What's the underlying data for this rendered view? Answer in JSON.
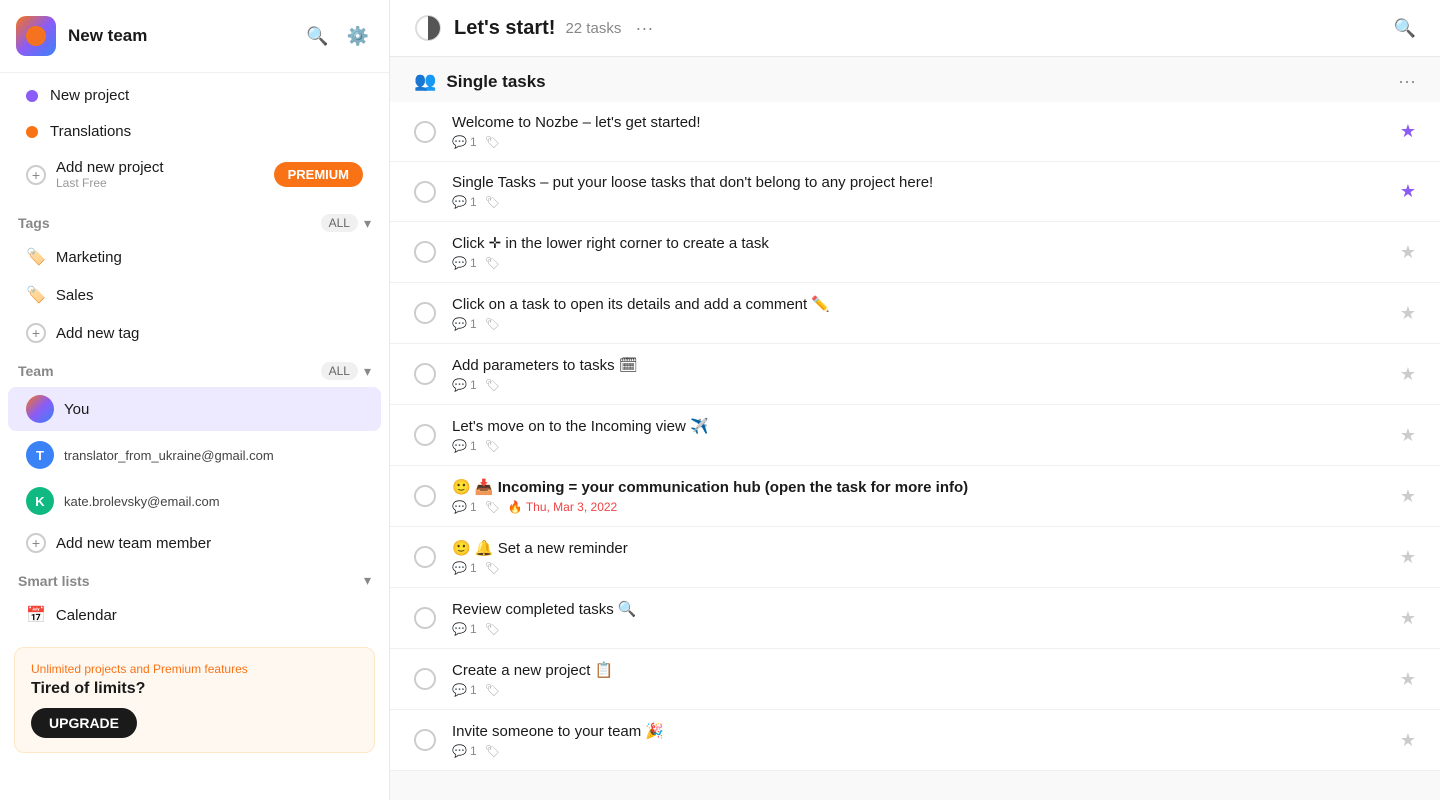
{
  "app": {
    "team_name": "New team",
    "logo_alt": "Nozbe logo"
  },
  "sidebar": {
    "header": {
      "title": "New team",
      "search_label": "Search",
      "settings_label": "Settings"
    },
    "projects": [
      {
        "id": "new-project",
        "label": "New project",
        "color": "purple"
      },
      {
        "id": "translations",
        "label": "Translations",
        "color": "orange"
      }
    ],
    "add_project": {
      "label": "Add new project",
      "sublabel": "Last Free",
      "premium_label": "PREMIUM"
    },
    "tags": {
      "section_title": "Tags",
      "all_label": "ALL",
      "items": [
        {
          "id": "marketing",
          "label": "Marketing",
          "icon": "🏷"
        },
        {
          "id": "sales",
          "label": "Sales",
          "icon": "🏷"
        }
      ],
      "add_label": "Add new tag"
    },
    "team": {
      "section_title": "Team",
      "all_label": "ALL",
      "members": [
        {
          "id": "you",
          "label": "You",
          "avatar_type": "multi"
        },
        {
          "id": "translator",
          "label": "translator_from_ukraine@gmail.com",
          "avatar_type": "blue",
          "initials": "T"
        },
        {
          "id": "kate",
          "label": "kate.brolevsky@email.com",
          "avatar_type": "green",
          "initials": "K"
        }
      ],
      "add_member_label": "Add new team member"
    },
    "smart_lists": {
      "section_title": "Smart lists",
      "items": [
        {
          "id": "calendar",
          "label": "Calendar",
          "icon": "📅"
        }
      ]
    },
    "upgrade": {
      "subtitle": "Unlimited projects and Premium features",
      "title": "Tired of limits?",
      "button_label": "UPGRADE"
    }
  },
  "main": {
    "header": {
      "title": "Let's start!",
      "task_count": "22 tasks",
      "more_label": "···"
    },
    "section": {
      "title": "Single tasks",
      "more_label": "···"
    },
    "tasks": [
      {
        "id": 1,
        "title": "Welcome to Nozbe – let's get started!",
        "comments": 1,
        "has_tag": true,
        "starred": true,
        "urgent_date": null
      },
      {
        "id": 2,
        "title": "Single Tasks – put your loose tasks that don't belong to any project here!",
        "comments": 1,
        "has_tag": true,
        "starred": true,
        "urgent_date": null
      },
      {
        "id": 3,
        "title": "Click ✛ in the lower right corner to create a task",
        "comments": 1,
        "has_tag": true,
        "starred": false,
        "urgent_date": null
      },
      {
        "id": 4,
        "title": "Click on a task to open its details and add a comment ✏️",
        "comments": 1,
        "has_tag": true,
        "starred": false,
        "urgent_date": null
      },
      {
        "id": 5,
        "title": "Add parameters to tasks 🗓",
        "comments": 1,
        "has_tag": true,
        "starred": false,
        "urgent_date": null
      },
      {
        "id": 6,
        "title": "Let's move on to the Incoming view ✈️",
        "comments": 1,
        "has_tag": true,
        "starred": false,
        "urgent_date": null
      },
      {
        "id": 7,
        "title": "🙂 📥 Incoming = your communication hub (open the task for more info)",
        "comments": 1,
        "has_tag": true,
        "starred": false,
        "urgent_date": "Thu, Mar 3, 2022",
        "is_bold": true
      },
      {
        "id": 8,
        "title": "🙂 🔔 Set a new reminder",
        "comments": 1,
        "has_tag": true,
        "starred": false,
        "urgent_date": null
      },
      {
        "id": 9,
        "title": "Review completed tasks 🔍",
        "comments": 1,
        "has_tag": true,
        "starred": false,
        "urgent_date": null
      },
      {
        "id": 10,
        "title": "Create a new project 📋",
        "comments": 1,
        "has_tag": true,
        "starred": false,
        "urgent_date": null
      },
      {
        "id": 11,
        "title": "Invite someone to your team 🎉",
        "comments": 1,
        "has_tag": true,
        "starred": false,
        "urgent_date": null
      }
    ]
  }
}
